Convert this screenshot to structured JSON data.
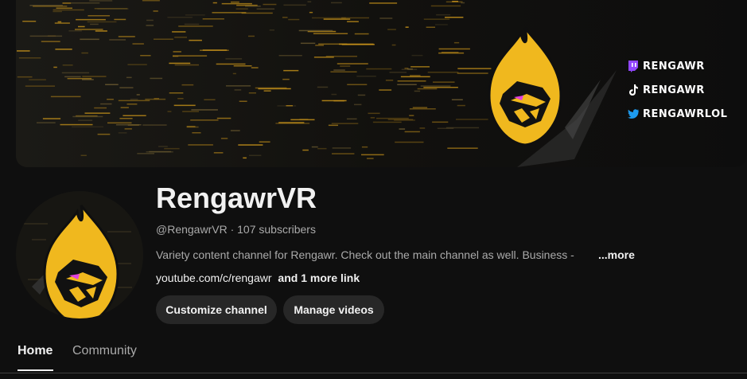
{
  "colors": {
    "background": "#0f0f0f",
    "brand_gold": "#f0b81e",
    "accent_pink": "#e040e0"
  },
  "banner": {
    "socials": [
      {
        "icon": "twitch-icon",
        "label": "RENGAWR"
      },
      {
        "icon": "tiktok-icon",
        "label": "RENGAWR"
      },
      {
        "icon": "twitter-icon",
        "label": "RENGAWRLOL"
      }
    ]
  },
  "channel": {
    "name": "RengawrVR",
    "handle_line": "@RengawrVR · 107 subscribers",
    "description": "Variety content channel for Rengawr. Check out the main channel as well.  Business -",
    "more_label": "...more",
    "link_url": "youtube.com/c/rengawr",
    "link_more": "and 1 more link"
  },
  "actions": {
    "customize": "Customize channel",
    "manage": "Manage videos"
  },
  "tabs": [
    {
      "label": "Home",
      "active": true
    },
    {
      "label": "Community",
      "active": false
    }
  ]
}
